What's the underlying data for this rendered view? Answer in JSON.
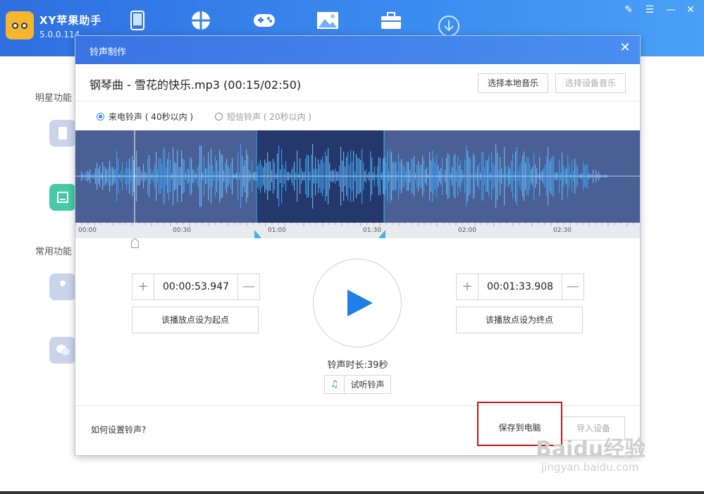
{
  "app": {
    "title": "XY苹果助手",
    "version": "5.0.0.114"
  },
  "nav": [
    {
      "icon": "phone-icon"
    },
    {
      "icon": "apps-icon"
    },
    {
      "icon": "game-controller-icon"
    },
    {
      "icon": "image-icon"
    },
    {
      "icon": "toolbox-icon"
    },
    {
      "icon": "download-icon"
    }
  ],
  "window_controls": [
    "✎",
    "☰",
    "—",
    "✕"
  ],
  "sidebar": {
    "section1": "明星功能",
    "section2": "常用功能"
  },
  "dialog": {
    "title": "铃声制作",
    "close": "✕",
    "song_title": "钢琴曲 - 雪花的快乐.mp3 (00:15/02:50)",
    "select_local": "选择本地音乐",
    "select_device": "选择设备音乐",
    "radio_call": "来电铃声 ( 40秒以内 )",
    "radio_sms": "短信铃声 ( 20秒以内 )",
    "ticks": [
      "00:00",
      "00:30",
      "01:00",
      "01:30",
      "02:00",
      "02:30"
    ],
    "start_time": "00:00:53.947",
    "end_time": "00:01:33.908",
    "plus": "+",
    "minus": "—",
    "set_start": "该播放点设为起点",
    "set_end": "该播放点设为终点",
    "duration": "铃声时长:39秒",
    "preview_icon": "♫",
    "preview": "试听铃声",
    "help": "如何设置铃声?",
    "save_pc": "保存到电脑",
    "import_device": "导入设备"
  },
  "colors": {
    "brand_blue": "#3a74e2",
    "play_blue": "#1e7fe6",
    "highlight_red": "#c9141b"
  },
  "watermark": {
    "main": "Baidu经验",
    "sub": "jingyan.baidu.com"
  }
}
